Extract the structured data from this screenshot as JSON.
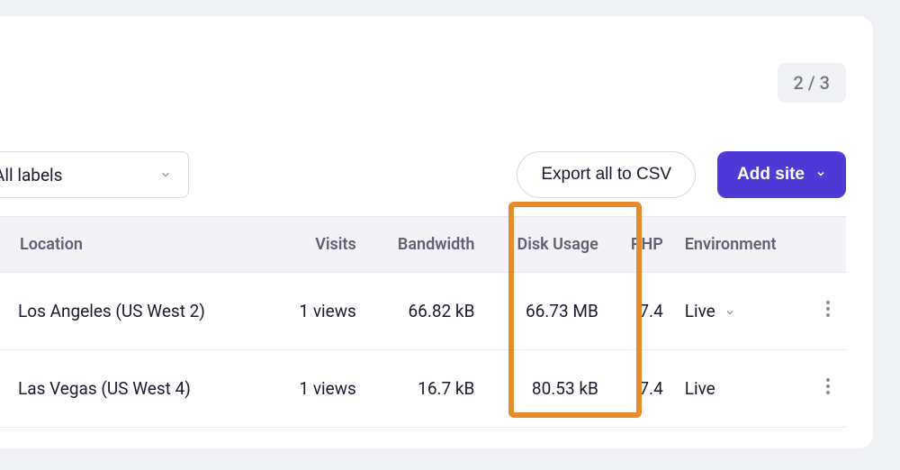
{
  "pager": {
    "text": "2 / 3"
  },
  "filters": {
    "labels_dropdown_label": "All labels"
  },
  "actions": {
    "export_label": "Export all to CSV",
    "add_site_label": "Add site"
  },
  "table": {
    "columns": {
      "location": "Location",
      "visits": "Visits",
      "bandwidth": "Bandwidth",
      "disk_usage": "Disk Usage",
      "php": "PHP",
      "environment": "Environment"
    },
    "rows": [
      {
        "location": "Los Angeles (US West 2)",
        "visits": "1 views",
        "bandwidth": "66.82 kB",
        "disk_usage": "66.73 MB",
        "php": "7.4",
        "environment": "Live",
        "has_env_dropdown": true
      },
      {
        "location": "Las Vegas (US West 4)",
        "visits": "1 views",
        "bandwidth": "16.7 kB",
        "disk_usage": "80.53 kB",
        "php": "7.4",
        "environment": "Live",
        "has_env_dropdown": false
      }
    ]
  },
  "highlight_column": "disk_usage"
}
